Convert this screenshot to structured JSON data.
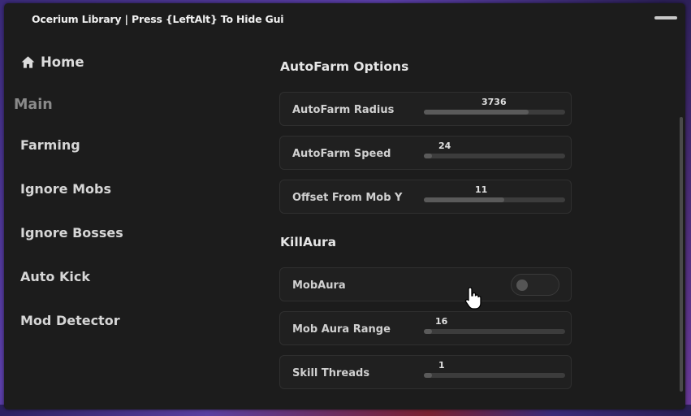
{
  "window": {
    "title": "Ocerium Library  |  Press {LeftAlt} To Hide Gui"
  },
  "sidebar": {
    "home_label": "Home",
    "section_label": "Main",
    "items": [
      {
        "label": "Farming"
      },
      {
        "label": "Ignore Mobs"
      },
      {
        "label": "Ignore Bosses"
      },
      {
        "label": "Auto Kick"
      },
      {
        "label": "Mod Detector"
      }
    ]
  },
  "autofarm": {
    "title": "AutoFarm Options",
    "radius": {
      "label": "AutoFarm Radius",
      "value": "3736",
      "fill_fraction": 0.74
    },
    "speed": {
      "label": "AutoFarm Speed",
      "value": "24",
      "fill_fraction": 0.05
    },
    "offset": {
      "label": "Offset From Mob Y",
      "value": "11",
      "fill_fraction": 0.57
    }
  },
  "killaura": {
    "title": "KillAura",
    "mobaura": {
      "label": "MobAura",
      "enabled": false
    },
    "range": {
      "label": "Mob Aura Range",
      "value": "16",
      "fill_fraction": 0.0
    },
    "threads": {
      "label": "Skill Threads",
      "value": "1",
      "fill_fraction": 0.0
    }
  }
}
